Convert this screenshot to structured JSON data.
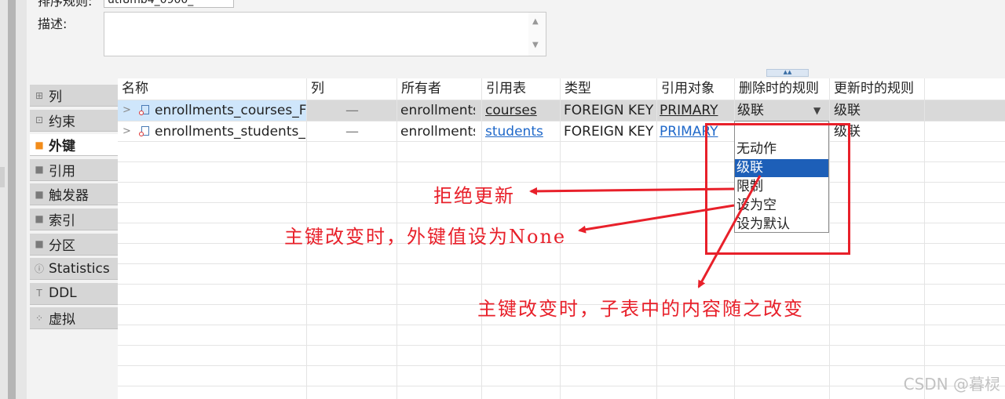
{
  "top": {
    "sort_label": "排序规则:",
    "sort_value": "utf8mb4_0900_",
    "desc_label": "描述:"
  },
  "sidebar": {
    "items": [
      {
        "label": "列",
        "icon": "columns-icon",
        "glyph": "⊞",
        "active": false
      },
      {
        "label": "约束",
        "icon": "constraint-icon",
        "glyph": "⊡",
        "active": false
      },
      {
        "label": "外键",
        "icon": "folder-icon",
        "glyph": "■",
        "active": true
      },
      {
        "label": "引用",
        "icon": "folder-icon",
        "glyph": "■",
        "active": false
      },
      {
        "label": "触发器",
        "icon": "folder-icon",
        "glyph": "■",
        "active": false
      },
      {
        "label": "索引",
        "icon": "folder-icon",
        "glyph": "■",
        "active": false
      },
      {
        "label": "分区",
        "icon": "folder-icon",
        "glyph": "■",
        "active": false
      },
      {
        "label": "Statistics",
        "icon": "info-icon",
        "glyph": "ⓘ",
        "active": false
      },
      {
        "label": "DDL",
        "icon": "ddl-icon",
        "glyph": "T",
        "active": false
      },
      {
        "label": "虚拟",
        "icon": "virtual-icon",
        "glyph": "⁘",
        "active": false
      }
    ]
  },
  "grid": {
    "headers": [
      "名称",
      "列",
      "所有者",
      "引用表",
      "类型",
      "引用对象",
      "删除时的规则",
      "更新时的规则"
    ],
    "rows": [
      {
        "name": "enrollments_courses_FK",
        "column": "—",
        "owner": "enrollments",
        "ref_table": "courses",
        "type": "FOREIGN KEY",
        "ref_object": "PRIMARY",
        "on_delete": "级联",
        "on_update": "级联"
      },
      {
        "name": "enrollments_students_FK",
        "column": "—",
        "owner": "enrollments",
        "ref_table": "students",
        "type": "FOREIGN KEY",
        "ref_object": "PRIMARY",
        "on_delete": "",
        "on_update": "级联"
      }
    ]
  },
  "dropdown": {
    "options": [
      "无动作",
      "级联",
      "限制",
      "设为空",
      "设为默认"
    ],
    "selected": "级联"
  },
  "annotations": {
    "restrict": "拒绝更新",
    "set_null": "主键改变时，外键值设为None",
    "cascade": "主键改变时，子表中的内容随之改变"
  },
  "colors": {
    "annotation": "#e8202a",
    "selection": "#1d5fb8",
    "active_icon": "#f28c1a"
  },
  "watermark": "CSDN @暮棂"
}
